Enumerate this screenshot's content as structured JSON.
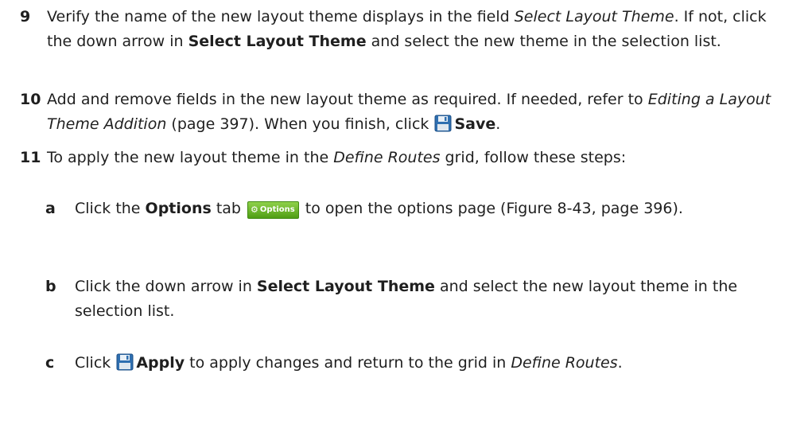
{
  "steps": [
    {
      "number": "9",
      "parts": [
        "Verify the name of the new layout theme displays in the field ",
        "Select Layout Theme",
        ". If not, click the down arrow in ",
        "Select Layout Theme",
        " and select the new theme in the selection list."
      ]
    },
    {
      "number": "10",
      "parts": [
        "Add and remove fields in the new layout theme as required. If needed, refer to ",
        "Editing a Layout Theme Addition",
        " (page 397). When you finish, click ",
        "Save",
        "."
      ]
    },
    {
      "number": "11",
      "parts": [
        "To apply the new layout theme in the ",
        "Define Routes",
        " grid, follow these steps:"
      ]
    }
  ],
  "substeps": [
    {
      "letter": "a",
      "parts": [
        "Click the ",
        "Options",
        " tab ",
        " to open the options page (Figure 8-43, page 396)."
      ],
      "tab_label": "Options"
    },
    {
      "letter": "b",
      "parts": [
        "Click the down arrow in ",
        "Select Layout Theme",
        " and select the new layout theme in the selection list."
      ]
    },
    {
      "letter": "c",
      "parts": [
        "Click ",
        "Apply",
        " to apply changes and return to the grid in ",
        "Define Routes",
        "."
      ]
    }
  ],
  "icons": {
    "save": "save-icon",
    "options_gear": "gear-icon"
  },
  "colors": {
    "text": "#1f1f1f",
    "options_tab": "#5aa81c"
  }
}
